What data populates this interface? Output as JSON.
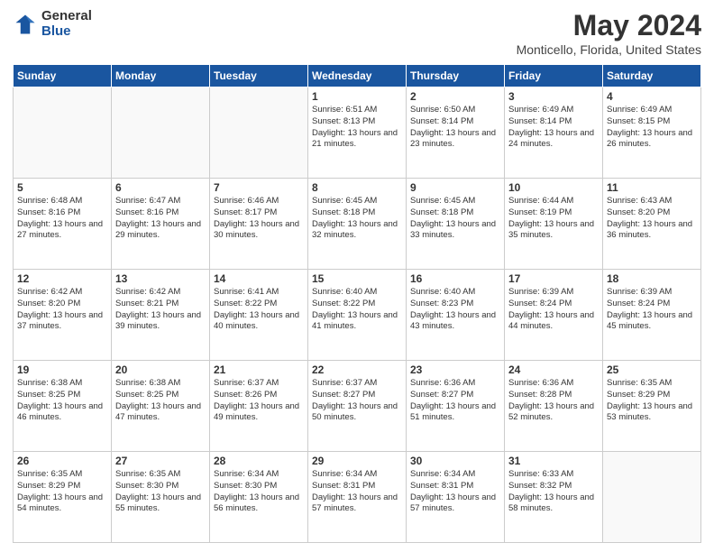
{
  "header": {
    "logo_general": "General",
    "logo_blue": "Blue",
    "main_title": "May 2024",
    "subtitle": "Monticello, Florida, United States"
  },
  "weekdays": [
    "Sunday",
    "Monday",
    "Tuesday",
    "Wednesday",
    "Thursday",
    "Friday",
    "Saturday"
  ],
  "weeks": [
    [
      {
        "day": "",
        "info": ""
      },
      {
        "day": "",
        "info": ""
      },
      {
        "day": "",
        "info": ""
      },
      {
        "day": "1",
        "info": "Sunrise: 6:51 AM\nSunset: 8:13 PM\nDaylight: 13 hours\nand 21 minutes."
      },
      {
        "day": "2",
        "info": "Sunrise: 6:50 AM\nSunset: 8:14 PM\nDaylight: 13 hours\nand 23 minutes."
      },
      {
        "day": "3",
        "info": "Sunrise: 6:49 AM\nSunset: 8:14 PM\nDaylight: 13 hours\nand 24 minutes."
      },
      {
        "day": "4",
        "info": "Sunrise: 6:49 AM\nSunset: 8:15 PM\nDaylight: 13 hours\nand 26 minutes."
      }
    ],
    [
      {
        "day": "5",
        "info": "Sunrise: 6:48 AM\nSunset: 8:16 PM\nDaylight: 13 hours\nand 27 minutes."
      },
      {
        "day": "6",
        "info": "Sunrise: 6:47 AM\nSunset: 8:16 PM\nDaylight: 13 hours\nand 29 minutes."
      },
      {
        "day": "7",
        "info": "Sunrise: 6:46 AM\nSunset: 8:17 PM\nDaylight: 13 hours\nand 30 minutes."
      },
      {
        "day": "8",
        "info": "Sunrise: 6:45 AM\nSunset: 8:18 PM\nDaylight: 13 hours\nand 32 minutes."
      },
      {
        "day": "9",
        "info": "Sunrise: 6:45 AM\nSunset: 8:18 PM\nDaylight: 13 hours\nand 33 minutes."
      },
      {
        "day": "10",
        "info": "Sunrise: 6:44 AM\nSunset: 8:19 PM\nDaylight: 13 hours\nand 35 minutes."
      },
      {
        "day": "11",
        "info": "Sunrise: 6:43 AM\nSunset: 8:20 PM\nDaylight: 13 hours\nand 36 minutes."
      }
    ],
    [
      {
        "day": "12",
        "info": "Sunrise: 6:42 AM\nSunset: 8:20 PM\nDaylight: 13 hours\nand 37 minutes."
      },
      {
        "day": "13",
        "info": "Sunrise: 6:42 AM\nSunset: 8:21 PM\nDaylight: 13 hours\nand 39 minutes."
      },
      {
        "day": "14",
        "info": "Sunrise: 6:41 AM\nSunset: 8:22 PM\nDaylight: 13 hours\nand 40 minutes."
      },
      {
        "day": "15",
        "info": "Sunrise: 6:40 AM\nSunset: 8:22 PM\nDaylight: 13 hours\nand 41 minutes."
      },
      {
        "day": "16",
        "info": "Sunrise: 6:40 AM\nSunset: 8:23 PM\nDaylight: 13 hours\nand 43 minutes."
      },
      {
        "day": "17",
        "info": "Sunrise: 6:39 AM\nSunset: 8:24 PM\nDaylight: 13 hours\nand 44 minutes."
      },
      {
        "day": "18",
        "info": "Sunrise: 6:39 AM\nSunset: 8:24 PM\nDaylight: 13 hours\nand 45 minutes."
      }
    ],
    [
      {
        "day": "19",
        "info": "Sunrise: 6:38 AM\nSunset: 8:25 PM\nDaylight: 13 hours\nand 46 minutes."
      },
      {
        "day": "20",
        "info": "Sunrise: 6:38 AM\nSunset: 8:25 PM\nDaylight: 13 hours\nand 47 minutes."
      },
      {
        "day": "21",
        "info": "Sunrise: 6:37 AM\nSunset: 8:26 PM\nDaylight: 13 hours\nand 49 minutes."
      },
      {
        "day": "22",
        "info": "Sunrise: 6:37 AM\nSunset: 8:27 PM\nDaylight: 13 hours\nand 50 minutes."
      },
      {
        "day": "23",
        "info": "Sunrise: 6:36 AM\nSunset: 8:27 PM\nDaylight: 13 hours\nand 51 minutes."
      },
      {
        "day": "24",
        "info": "Sunrise: 6:36 AM\nSunset: 8:28 PM\nDaylight: 13 hours\nand 52 minutes."
      },
      {
        "day": "25",
        "info": "Sunrise: 6:35 AM\nSunset: 8:29 PM\nDaylight: 13 hours\nand 53 minutes."
      }
    ],
    [
      {
        "day": "26",
        "info": "Sunrise: 6:35 AM\nSunset: 8:29 PM\nDaylight: 13 hours\nand 54 minutes."
      },
      {
        "day": "27",
        "info": "Sunrise: 6:35 AM\nSunset: 8:30 PM\nDaylight: 13 hours\nand 55 minutes."
      },
      {
        "day": "28",
        "info": "Sunrise: 6:34 AM\nSunset: 8:30 PM\nDaylight: 13 hours\nand 56 minutes."
      },
      {
        "day": "29",
        "info": "Sunrise: 6:34 AM\nSunset: 8:31 PM\nDaylight: 13 hours\nand 57 minutes."
      },
      {
        "day": "30",
        "info": "Sunrise: 6:34 AM\nSunset: 8:31 PM\nDaylight: 13 hours\nand 57 minutes."
      },
      {
        "day": "31",
        "info": "Sunrise: 6:33 AM\nSunset: 8:32 PM\nDaylight: 13 hours\nand 58 minutes."
      },
      {
        "day": "",
        "info": ""
      }
    ]
  ]
}
